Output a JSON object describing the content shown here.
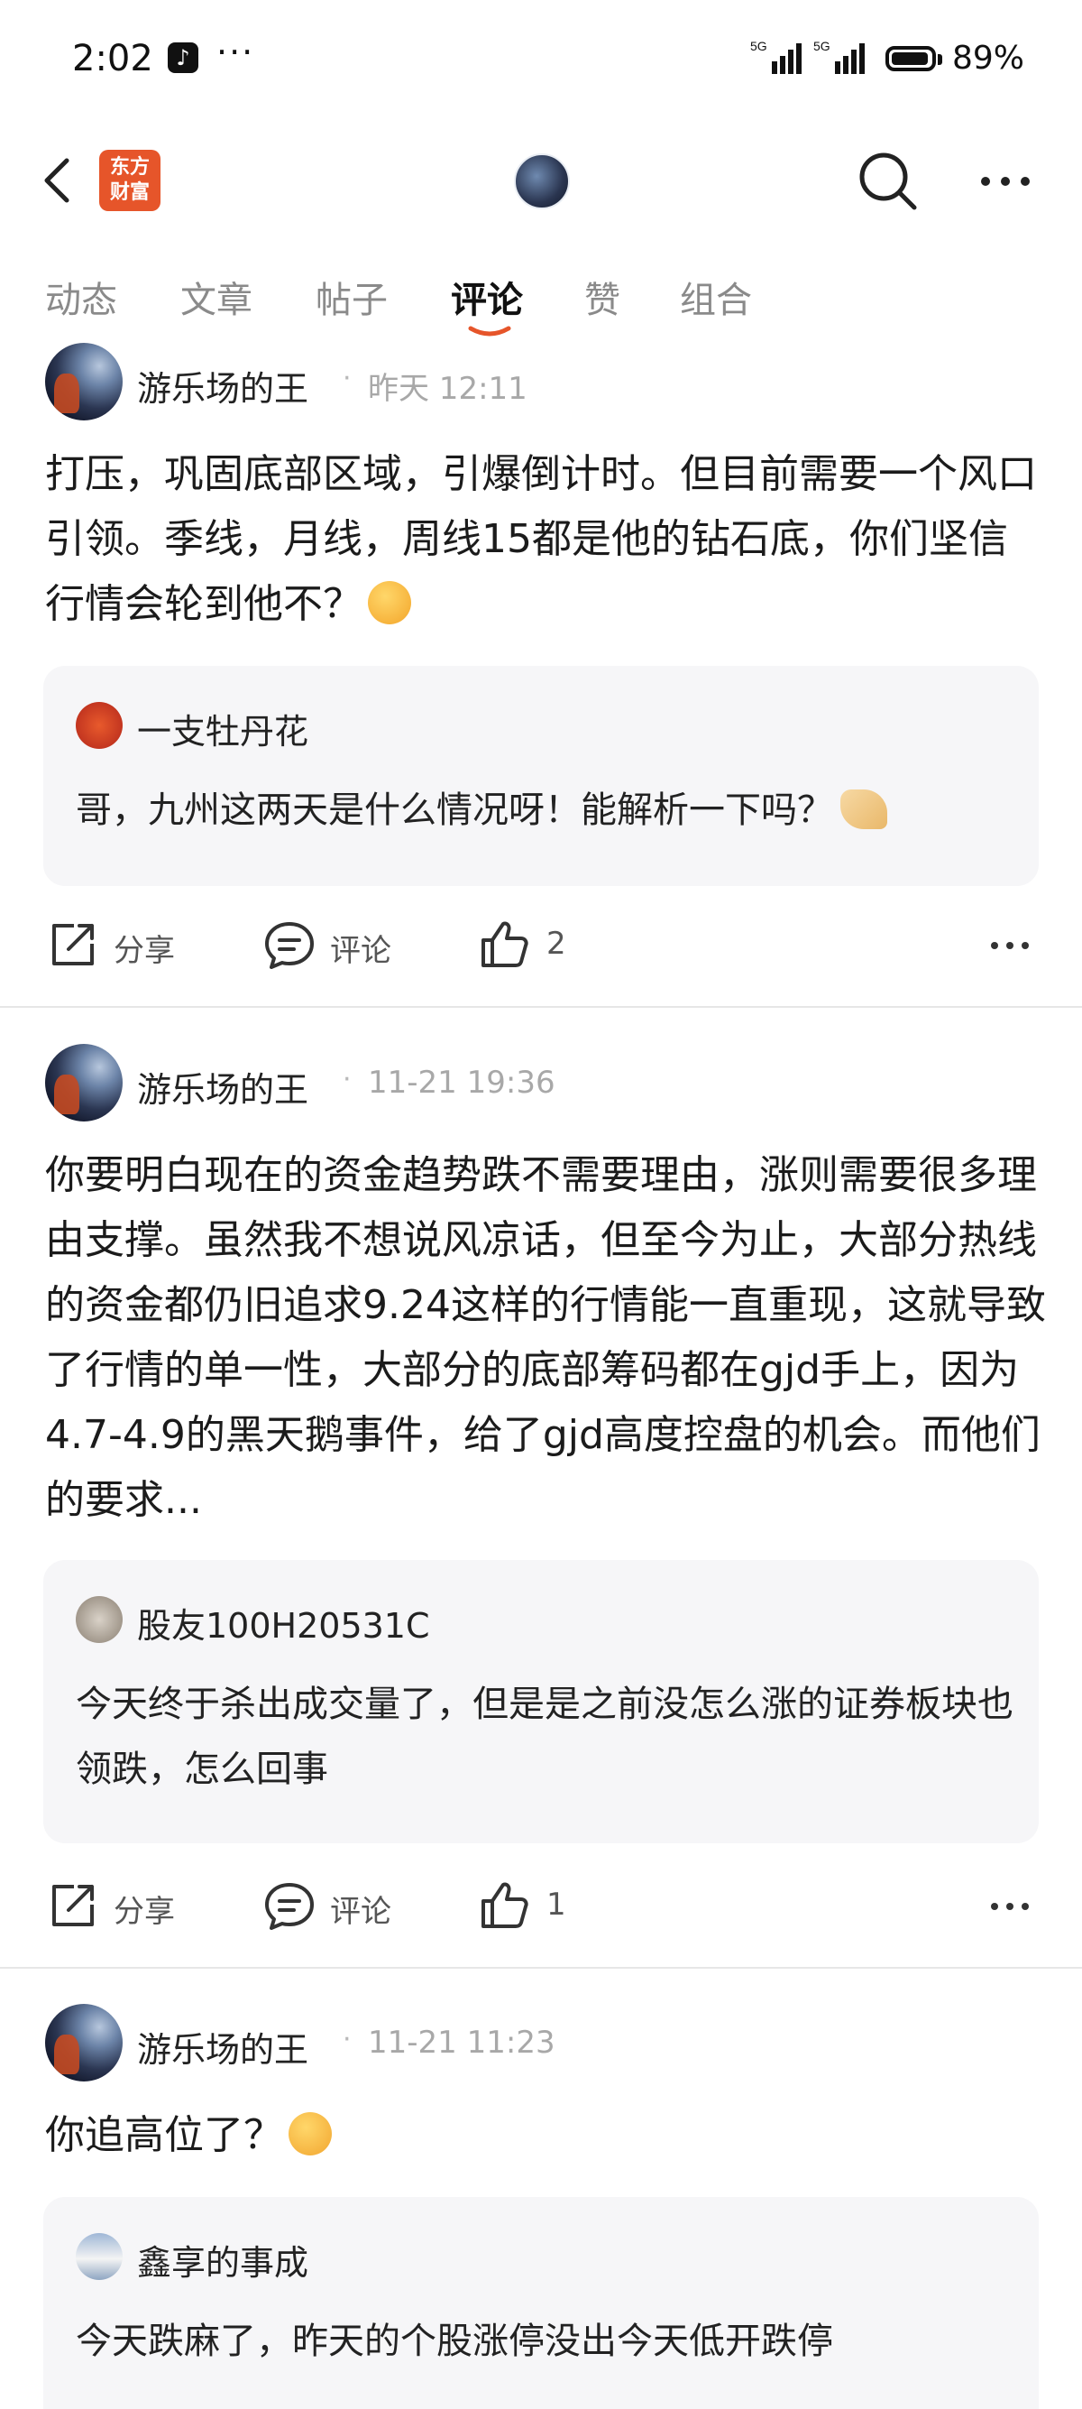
{
  "status_bar": {
    "time": "2:02",
    "app_icon": "tiktok-icon",
    "dots": "···",
    "signal1": "5G",
    "signal2": "5G",
    "battery": "89%"
  },
  "header": {
    "logo_text_line1": "东方",
    "logo_text_line2": "财富"
  },
  "tabs": [
    {
      "label": "动态"
    },
    {
      "label": "文章"
    },
    {
      "label": "帖子"
    },
    {
      "label": "评论"
    },
    {
      "label": "赞"
    },
    {
      "label": "组合"
    }
  ],
  "active_tab": "评论",
  "accent_color": "#e6552a",
  "posts": [
    {
      "user": "游乐场的王",
      "time": "昨天 12:11",
      "content": "打压，巩固底部区域，引爆倒计时。但目前需要一个风口引领。季线，月线，周线15都是他的钻石底，你们坚信行情会轮到他不？",
      "quote_user": "一支牡丹花",
      "quote_text": "哥，九州这两天是什么情况呀！能解析一下吗？",
      "share": "分享",
      "comment": "评论",
      "likes": "2"
    },
    {
      "user": "游乐场的王",
      "time": "11-21 19:36",
      "content": "你要明白现在的资金趋势跌不需要理由，涨则需要很多理由支撑。虽然我不想说风凉话，但至今为止，大部分热线的资金都仍旧追求9.24这样的行情能一直重现，这就导致了行情的单一性，大部分的底部筹码都在gjd手上，因为4.7-4.9的黑天鹅事件，给了gjd高度控盘的机会。而他们的要求...",
      "quote_user": "股友100H20531C",
      "quote_text": "今天终于杀出成交量了，但是是之前没怎么涨的证券板块也领跌，怎么回事",
      "share": "分享",
      "comment": "评论",
      "likes": "1"
    },
    {
      "user": "游乐场的王",
      "time": "11-21 11:23",
      "content": "你追高位了？",
      "quote_user": "鑫享的事成",
      "quote_text": "今天跌麻了，昨天的个股涨停没出今天低开跌停"
    }
  ]
}
